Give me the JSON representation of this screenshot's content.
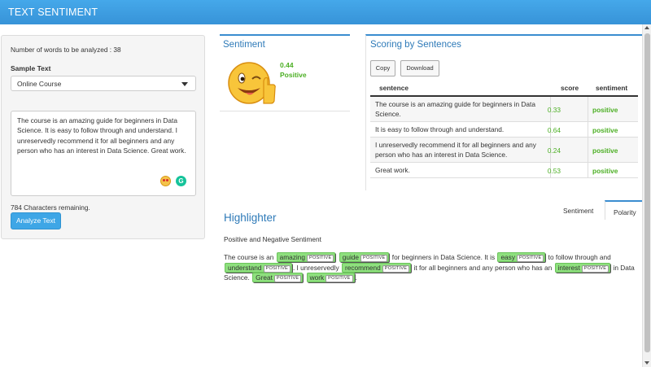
{
  "app": {
    "title": "TEXT SENTIMENT"
  },
  "input": {
    "word_count": "Number of words to be analyzed : 38",
    "sample_label": "Sample Text",
    "sample_value": "Online Course",
    "text": "The course is an amazing guide for beginners in Data Science. It is easy to follow through and understand. I unreservedly recommend it for all beginners and any person who has an interest in Data Science. Great work.",
    "chars_remaining": "784 Characters remaining.",
    "analyze_label": "Analyze Text",
    "icons": [
      "star-struck-emoji-icon",
      "grammarly-icon"
    ]
  },
  "sentiment": {
    "title": "Sentiment",
    "score": "0.44",
    "label": "Positive",
    "face_icon": "winking-thumbs-up-emoji-icon"
  },
  "scoring": {
    "title": "Scoring by Sentences",
    "copy_label": "Copy",
    "download_label": "Download",
    "columns": [
      "sentence",
      "score",
      "sentiment"
    ],
    "rows": [
      {
        "sentence": "The course is an amazing guide for beginners in Data Science.",
        "score": "0.33",
        "sentiment": "positive"
      },
      {
        "sentence": "It is easy to follow through and understand.",
        "score": "0.64",
        "sentiment": "positive"
      },
      {
        "sentence": "I unreservedly recommend it for all beginners and any person who has an interest in Data Science.",
        "score": "0.24",
        "sentiment": "positive"
      },
      {
        "sentence": "Great work.",
        "score": "0.53",
        "sentiment": "positive"
      }
    ]
  },
  "highlighter": {
    "title": "Highlighter",
    "subtitle": "Positive and Negative Sentiment",
    "tabs": [
      "Sentiment",
      "Polarity"
    ],
    "active_tab": "Polarity",
    "tag": "POSITIVE",
    "segments": [
      {
        "text": "The course is an "
      },
      {
        "text": "amazing",
        "hl": true
      },
      {
        "text": " "
      },
      {
        "text": "guide",
        "hl": true
      },
      {
        "text": " for beginners in Data Science. It is "
      },
      {
        "text": "easy",
        "hl": true
      },
      {
        "text": " to follow through and "
      },
      {
        "text": "understand",
        "hl": true
      },
      {
        "text": ". I unreservedly "
      },
      {
        "text": "recommend",
        "hl": true
      },
      {
        "text": " it for all beginners and any person who has an "
      },
      {
        "text": "interest",
        "hl": true
      },
      {
        "text": " in Data Science. "
      },
      {
        "text": "Great",
        "hl": true
      },
      {
        "text": " "
      },
      {
        "text": "work",
        "hl": true
      },
      {
        "text": "."
      }
    ]
  },
  "colors": {
    "accent": "#3a8dd0",
    "positive": "#4caf24",
    "highlight": "#8ee07e",
    "topbar": "#3c9be0"
  }
}
